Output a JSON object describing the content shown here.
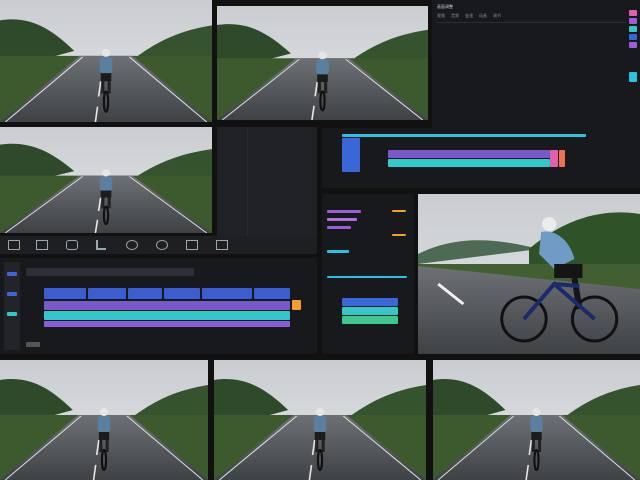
{
  "editor": {
    "window_title": "画面调整",
    "menu": [
      "视频",
      "音频",
      "变速",
      "动画",
      "调节"
    ],
    "colors": {
      "teal": "#32c8c8",
      "purple": "#9a5ed8",
      "pink": "#e060b0",
      "blue": "#3a66d8",
      "green": "#3ec890",
      "orange": "#f0a030",
      "cyan": "#2ec0e0"
    }
  },
  "toolbar_icons": [
    "split-icon",
    "delete-icon",
    "freeze-icon",
    "crop-icon",
    "mirror-icon",
    "rotate-icon",
    "speed-icon",
    "audio-icon"
  ],
  "timeline": {
    "clip_count": 6,
    "playhead_color": "#f0a030"
  },
  "photos": [
    {
      "name": "cyclist-photo-1"
    },
    {
      "name": "cyclist-photo-2"
    },
    {
      "name": "cyclist-photo-3"
    },
    {
      "name": "cyclist-photo-4"
    },
    {
      "name": "cyclist-photo-5"
    },
    {
      "name": "cyclist-photo-6"
    },
    {
      "name": "cyclist-photo-7"
    }
  ]
}
